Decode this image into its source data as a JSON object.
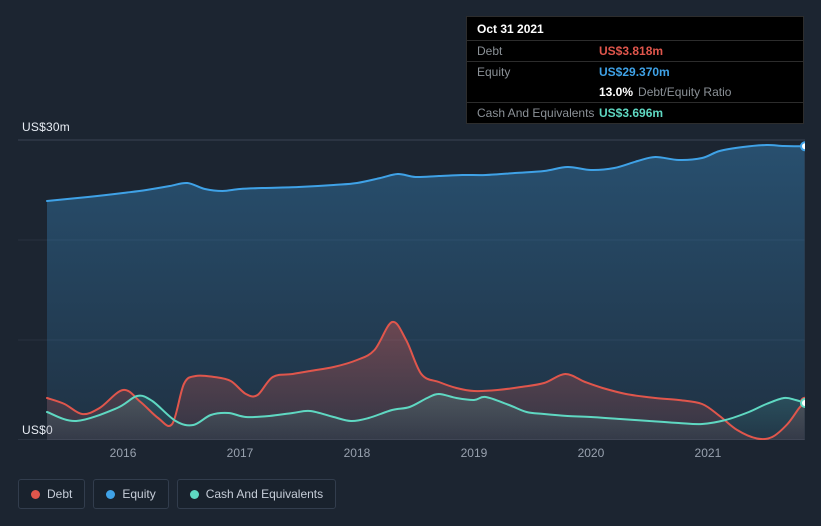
{
  "tooltip": {
    "date": "Oct 31 2021",
    "debt_label": "Debt",
    "debt_value": "US$3.818m",
    "equity_label": "Equity",
    "equity_value": "US$29.370m",
    "ratio_value": "13.0%",
    "ratio_label": "Debt/Equity Ratio",
    "cash_label": "Cash And Equivalents",
    "cash_value": "US$3.696m"
  },
  "axis": {
    "y_top": "US$30m",
    "y_bottom": "US$0"
  },
  "legend": [
    {
      "label": "Debt",
      "color": "#e0564c"
    },
    {
      "label": "Equity",
      "color": "#3fa2e7"
    },
    {
      "label": "Cash And Equivalents",
      "color": "#5fd8c2"
    }
  ],
  "colors": {
    "background": "#1c2531",
    "grid_strong": "#3a4452",
    "grid_faint": "#27313f",
    "debt": "#e0564c",
    "equity": "#3fa2e7",
    "cash": "#5fd8c2",
    "tooltip_bg": "#000000"
  },
  "chart_data": {
    "type": "area",
    "title": "",
    "x_ticks": [
      2016,
      2017,
      2018,
      2019,
      2020,
      2021
    ],
    "x_range": [
      2015.35,
      2021.83
    ],
    "y_range_m": [
      0,
      30
    ],
    "gridlines_m": [
      0,
      10,
      20,
      30
    ],
    "ylabel": "US$ millions",
    "legend_position": "bottom-left",
    "last_point": {
      "date": "Oct 31 2021",
      "debt_m": 3.818,
      "equity_m": 29.37,
      "cash_m": 3.696,
      "debt_equity_ratio_pct": 13.0
    },
    "series": [
      {
        "name": "Equity",
        "color": "#3fa2e7",
        "points": [
          [
            2015.35,
            23.9
          ],
          [
            2015.7,
            24.3
          ],
          [
            2016.0,
            24.7
          ],
          [
            2016.2,
            25.0
          ],
          [
            2016.4,
            25.4
          ],
          [
            2016.55,
            25.7
          ],
          [
            2016.7,
            25.1
          ],
          [
            2016.85,
            24.9
          ],
          [
            2017.0,
            25.1
          ],
          [
            2017.2,
            25.2
          ],
          [
            2017.5,
            25.3
          ],
          [
            2017.8,
            25.5
          ],
          [
            2018.0,
            25.7
          ],
          [
            2018.2,
            26.2
          ],
          [
            2018.35,
            26.6
          ],
          [
            2018.5,
            26.3
          ],
          [
            2018.7,
            26.4
          ],
          [
            2018.9,
            26.5
          ],
          [
            2019.1,
            26.5
          ],
          [
            2019.35,
            26.7
          ],
          [
            2019.6,
            26.9
          ],
          [
            2019.8,
            27.3
          ],
          [
            2020.0,
            27.0
          ],
          [
            2020.2,
            27.2
          ],
          [
            2020.4,
            27.9
          ],
          [
            2020.55,
            28.3
          ],
          [
            2020.75,
            28.0
          ],
          [
            2020.95,
            28.2
          ],
          [
            2021.1,
            28.9
          ],
          [
            2021.3,
            29.3
          ],
          [
            2021.5,
            29.5
          ],
          [
            2021.65,
            29.4
          ],
          [
            2021.83,
            29.37
          ]
        ]
      },
      {
        "name": "Debt",
        "color": "#e0564c",
        "points": [
          [
            2015.35,
            4.2
          ],
          [
            2015.5,
            3.6
          ],
          [
            2015.65,
            2.6
          ],
          [
            2015.8,
            3.2
          ],
          [
            2016.0,
            5.0
          ],
          [
            2016.15,
            3.8
          ],
          [
            2016.3,
            2.2
          ],
          [
            2016.42,
            1.6
          ],
          [
            2016.52,
            5.6
          ],
          [
            2016.62,
            6.4
          ],
          [
            2016.78,
            6.3
          ],
          [
            2016.92,
            5.9
          ],
          [
            2017.05,
            4.6
          ],
          [
            2017.15,
            4.5
          ],
          [
            2017.28,
            6.3
          ],
          [
            2017.45,
            6.6
          ],
          [
            2017.6,
            6.9
          ],
          [
            2017.8,
            7.3
          ],
          [
            2018.0,
            8.0
          ],
          [
            2018.15,
            9.0
          ],
          [
            2018.3,
            11.8
          ],
          [
            2018.42,
            10.0
          ],
          [
            2018.55,
            6.6
          ],
          [
            2018.7,
            5.8
          ],
          [
            2018.85,
            5.2
          ],
          [
            2019.0,
            4.9
          ],
          [
            2019.2,
            5.0
          ],
          [
            2019.4,
            5.3
          ],
          [
            2019.6,
            5.7
          ],
          [
            2019.78,
            6.6
          ],
          [
            2019.95,
            5.8
          ],
          [
            2020.1,
            5.2
          ],
          [
            2020.3,
            4.6
          ],
          [
            2020.55,
            4.2
          ],
          [
            2020.75,
            4.0
          ],
          [
            2020.95,
            3.6
          ],
          [
            2021.1,
            2.4
          ],
          [
            2021.25,
            1.0
          ],
          [
            2021.42,
            0.15
          ],
          [
            2021.55,
            0.3
          ],
          [
            2021.68,
            1.6
          ],
          [
            2021.78,
            3.2
          ],
          [
            2021.83,
            3.818
          ]
        ]
      },
      {
        "name": "Cash And Equivalents",
        "color": "#5fd8c2",
        "points": [
          [
            2015.35,
            2.8
          ],
          [
            2015.6,
            1.9
          ],
          [
            2015.95,
            3.2
          ],
          [
            2016.12,
            4.4
          ],
          [
            2016.25,
            3.9
          ],
          [
            2016.45,
            1.9
          ],
          [
            2016.6,
            1.5
          ],
          [
            2016.75,
            2.5
          ],
          [
            2016.9,
            2.7
          ],
          [
            2017.05,
            2.3
          ],
          [
            2017.25,
            2.4
          ],
          [
            2017.45,
            2.7
          ],
          [
            2017.6,
            2.9
          ],
          [
            2017.8,
            2.3
          ],
          [
            2017.95,
            1.9
          ],
          [
            2018.1,
            2.2
          ],
          [
            2018.3,
            3.0
          ],
          [
            2018.45,
            3.3
          ],
          [
            2018.6,
            4.2
          ],
          [
            2018.7,
            4.6
          ],
          [
            2018.85,
            4.2
          ],
          [
            2019.0,
            4.0
          ],
          [
            2019.1,
            4.3
          ],
          [
            2019.3,
            3.5
          ],
          [
            2019.45,
            2.8
          ],
          [
            2019.6,
            2.6
          ],
          [
            2019.8,
            2.4
          ],
          [
            2020.0,
            2.3
          ],
          [
            2020.25,
            2.1
          ],
          [
            2020.5,
            1.9
          ],
          [
            2020.75,
            1.7
          ],
          [
            2020.95,
            1.6
          ],
          [
            2021.15,
            2.0
          ],
          [
            2021.35,
            2.8
          ],
          [
            2021.5,
            3.6
          ],
          [
            2021.65,
            4.2
          ],
          [
            2021.75,
            4.0
          ],
          [
            2021.83,
            3.696
          ]
        ]
      }
    ]
  }
}
